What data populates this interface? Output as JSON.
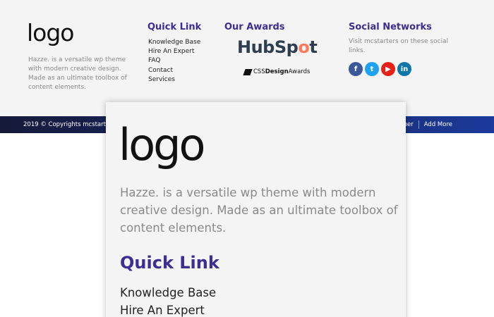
{
  "footer": {
    "logo": "logo",
    "about": "Hazze. is a versatile wp theme with modern creative design. Made as an ultimate toolbox of content elements.",
    "quick_link": {
      "title": "Quick Link",
      "items": [
        "Knowledge Base",
        "Hire An Expert",
        "FAQ",
        "Contact",
        "Services"
      ]
    },
    "awards": {
      "title": "Our Awards",
      "hubspot_pre": "HubSp",
      "hubspot_mark": "o",
      "hubspot_post": "t",
      "cssda_pre": "CSS",
      "cssda_bold": "Design",
      "cssda_post": "Awards"
    },
    "social": {
      "title": "Social Networks",
      "text": "Visit mcstarters on these social links.",
      "icons": [
        {
          "name": "facebook-icon",
          "glyph": "f",
          "color": "#3b5998"
        },
        {
          "name": "twitter-icon",
          "glyph": "t",
          "color": "#1da1f2"
        },
        {
          "name": "youtube-icon",
          "glyph": "▶",
          "color": "#e62117"
        },
        {
          "name": "linkedin-icon",
          "glyph": "in",
          "color": "#0e76a8"
        }
      ]
    }
  },
  "bar": {
    "copyright": "2019 © Copyrights mcstarters.",
    "links": [
      "aimer",
      "Add More"
    ]
  },
  "zoom": {
    "logo": "logo",
    "about": "Hazze. is a versatile wp theme with modern creative design. Made as an ultimate toolbox of content elements.",
    "quick_link_title": "Quick Link",
    "items": [
      "Knowledge Base",
      "Hire An Expert"
    ]
  },
  "colors": {
    "heading": "#3d2d94",
    "bar_start": "#151a3a",
    "bar_end": "#1b3a9a"
  }
}
